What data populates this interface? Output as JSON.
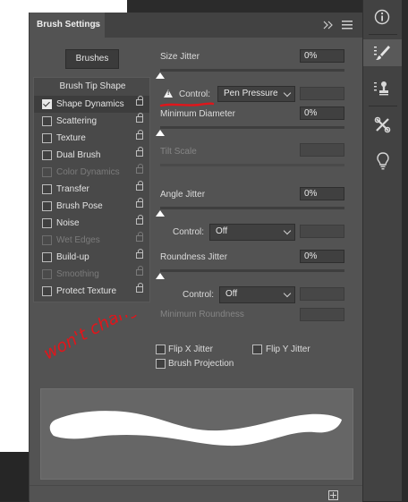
{
  "panel": {
    "tab_title": "Brush Settings",
    "tab_close": "×",
    "collapse_icon": "double-chevron-right-icon",
    "menu_icon": "hamburger-menu-icon"
  },
  "brushes_button": "Brushes",
  "sections": {
    "header": "Brush Tip Shape",
    "items": [
      {
        "label": "Shape Dynamics",
        "checked": true,
        "enabled": true,
        "selected": true
      },
      {
        "label": "Scattering",
        "checked": false,
        "enabled": true
      },
      {
        "label": "Texture",
        "checked": false,
        "enabled": true
      },
      {
        "label": "Dual Brush",
        "checked": false,
        "enabled": true
      },
      {
        "label": "Color Dynamics",
        "checked": false,
        "enabled": false
      },
      {
        "label": "Transfer",
        "checked": false,
        "enabled": true
      },
      {
        "label": "Brush Pose",
        "checked": false,
        "enabled": true
      },
      {
        "label": "Noise",
        "checked": false,
        "enabled": true
      },
      {
        "label": "Wet Edges",
        "checked": false,
        "enabled": false
      },
      {
        "label": "Build-up",
        "checked": false,
        "enabled": true
      },
      {
        "label": "Smoothing",
        "checked": false,
        "enabled": false
      },
      {
        "label": "Protect Texture",
        "checked": false,
        "enabled": true
      }
    ]
  },
  "settings": {
    "size_jitter": {
      "label": "Size Jitter",
      "value": "0%"
    },
    "size_control": {
      "label": "Control:",
      "value": "Pen Pressure"
    },
    "minimum_diameter": {
      "label": "Minimum Diameter",
      "value": "0%"
    },
    "tilt_scale": {
      "label": "Tilt Scale",
      "value": ""
    },
    "angle_jitter": {
      "label": "Angle Jitter",
      "value": "0%"
    },
    "angle_control": {
      "label": "Control:",
      "value": "Off"
    },
    "roundness_jitter": {
      "label": "Roundness Jitter",
      "value": "0%"
    },
    "roundness_control": {
      "label": "Control:",
      "value": "Off"
    },
    "minimum_roundness": {
      "label": "Minimum Roundness",
      "value": ""
    },
    "flip_x": {
      "label": "Flip X Jitter",
      "checked": false
    },
    "flip_y": {
      "label": "Flip Y Jitter",
      "checked": false
    },
    "brush_projection": {
      "label": "Brush Projection",
      "checked": false
    }
  },
  "annotation": {
    "text": "won't change",
    "color": "#e0161b"
  },
  "toolbar_icons": [
    "info-icon",
    "brush-settings-icon",
    "clone-source-icon",
    "tools-icon",
    "lightbulb-icon"
  ],
  "colors": {
    "panel": "#535353",
    "accent_red": "#e0161b",
    "track": "#3e3e3e"
  }
}
